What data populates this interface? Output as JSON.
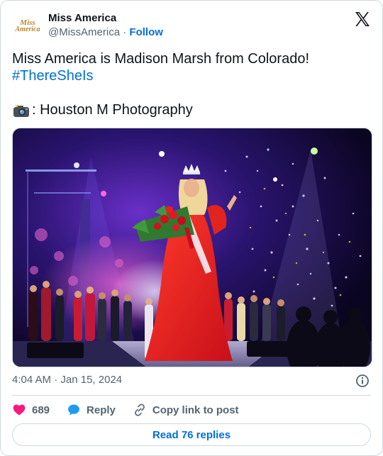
{
  "author": {
    "logo_line1": "Miss",
    "logo_line2": "America",
    "name": "Miss America",
    "handle": "@MissAmerica",
    "separator": "·",
    "follow_label": "Follow"
  },
  "post": {
    "text_line1": "Miss America is Madison Marsh from Colorado!",
    "hashtag": "#ThereSheIs",
    "credit": ": Houston M Photography"
  },
  "meta": {
    "time": "4:04 AM",
    "separator": "·",
    "date": "Jan 15, 2024"
  },
  "actions": {
    "like_count": "689",
    "reply_label": "Reply",
    "copy_label": "Copy link to post"
  },
  "footer": {
    "read_replies_label": "Read 76 replies"
  },
  "colors": {
    "link_blue": "#006fd6",
    "like_red": "#f91880",
    "muted_gray": "#536471",
    "border": "#cfd9de"
  },
  "icons": [
    "x-logo-icon",
    "camera-flash-icon",
    "info-icon",
    "heart-icon",
    "speech-bubble-icon",
    "link-icon"
  ]
}
